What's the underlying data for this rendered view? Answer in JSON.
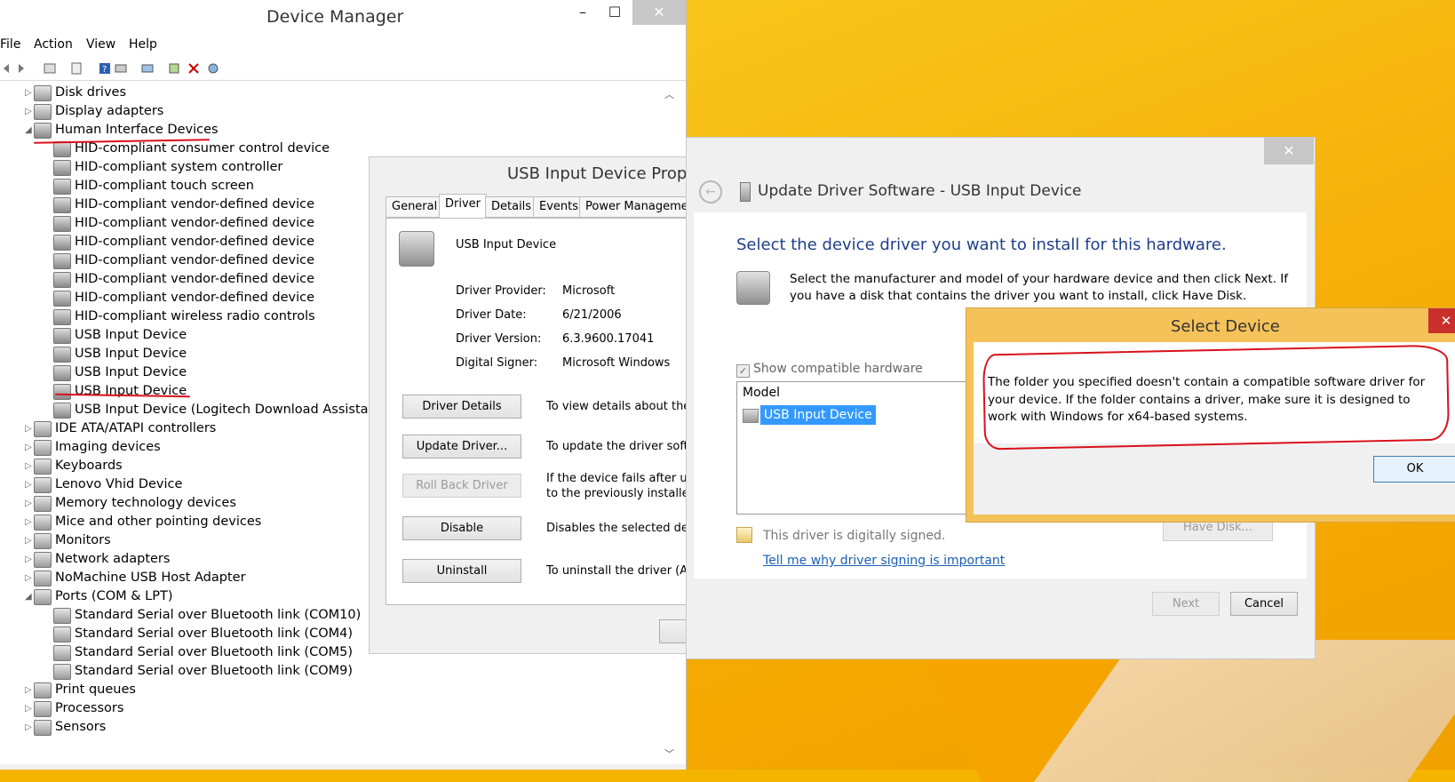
{
  "device_manager": {
    "title": "Device Manager",
    "window_controls": {
      "minimize": "–",
      "maximize": "☐",
      "close": "✕"
    },
    "menu": [
      "File",
      "Action",
      "View",
      "Help"
    ],
    "tree": [
      {
        "label": "Disk drives",
        "level": 0,
        "expanded": false
      },
      {
        "label": "Display adapters",
        "level": 0,
        "expanded": false
      },
      {
        "label": "Human Interface Devices",
        "level": 0,
        "expanded": true
      },
      {
        "label": "HID-compliant consumer control device",
        "level": 1
      },
      {
        "label": "HID-compliant system controller",
        "level": 1
      },
      {
        "label": "HID-compliant touch screen",
        "level": 1
      },
      {
        "label": "HID-compliant vendor-defined device",
        "level": 1
      },
      {
        "label": "HID-compliant vendor-defined device",
        "level": 1
      },
      {
        "label": "HID-compliant vendor-defined device",
        "level": 1
      },
      {
        "label": "HID-compliant vendor-defined device",
        "level": 1
      },
      {
        "label": "HID-compliant vendor-defined device",
        "level": 1
      },
      {
        "label": "HID-compliant vendor-defined device",
        "level": 1
      },
      {
        "label": "HID-compliant wireless radio controls",
        "level": 1
      },
      {
        "label": "USB Input Device",
        "level": 1
      },
      {
        "label": "USB Input Device",
        "level": 1
      },
      {
        "label": "USB Input Device",
        "level": 1
      },
      {
        "label": "USB Input Device",
        "level": 1
      },
      {
        "label": "USB Input Device (Logitech Download Assistant)",
        "level": 1
      },
      {
        "label": "IDE ATA/ATAPI controllers",
        "level": 0,
        "expanded": false
      },
      {
        "label": "Imaging devices",
        "level": 0,
        "expanded": false
      },
      {
        "label": "Keyboards",
        "level": 0,
        "expanded": false
      },
      {
        "label": "Lenovo Vhid Device",
        "level": 0,
        "expanded": false
      },
      {
        "label": "Memory technology devices",
        "level": 0,
        "expanded": false
      },
      {
        "label": "Mice and other pointing devices",
        "level": 0,
        "expanded": false
      },
      {
        "label": "Monitors",
        "level": 0,
        "expanded": false
      },
      {
        "label": "Network adapters",
        "level": 0,
        "expanded": false
      },
      {
        "label": "NoMachine USB Host Adapter",
        "level": 0,
        "expanded": false
      },
      {
        "label": "Ports (COM & LPT)",
        "level": 0,
        "expanded": true
      },
      {
        "label": "Standard Serial over Bluetooth link (COM10)",
        "level": 1
      },
      {
        "label": "Standard Serial over Bluetooth link (COM4)",
        "level": 1
      },
      {
        "label": "Standard Serial over Bluetooth link (COM5)",
        "level": 1
      },
      {
        "label": "Standard Serial over Bluetooth link (COM9)",
        "level": 1
      },
      {
        "label": "Print queues",
        "level": 0,
        "expanded": false
      },
      {
        "label": "Processors",
        "level": 0,
        "expanded": false
      },
      {
        "label": "Sensors",
        "level": 0,
        "expanded": false
      }
    ]
  },
  "properties": {
    "title": "USB Input Device Prope",
    "tabs": [
      "General",
      "Driver",
      "Details",
      "Events",
      "Power Managemen"
    ],
    "active_tab": "Driver",
    "device_name": "USB Input Device",
    "fields": {
      "provider_label": "Driver Provider:",
      "provider_value": "Microsoft",
      "date_label": "Driver Date:",
      "date_value": "6/21/2006",
      "version_label": "Driver Version:",
      "version_value": "6.3.9600.17041",
      "signer_label": "Digital Signer:",
      "signer_value": "Microsoft Windows"
    },
    "buttons": {
      "details": "Driver Details",
      "details_desc": "To view details about the d",
      "update": "Update Driver...",
      "update_desc": "To update the driver softw",
      "rollback": "Roll Back Driver",
      "rollback_desc1": "If the device fails after upd",
      "rollback_desc2": "to the previously installed",
      "disable": "Disable",
      "disable_desc": "Disables the selected dev",
      "uninstall": "Uninstall",
      "uninstall_desc": "To uninstall the driver (Adv"
    }
  },
  "update_driver": {
    "window_title": "Update Driver Software - USB Input Device",
    "heading": "Select the device driver you want to install for this hardware.",
    "description": "Select the manufacturer and model of your hardware device and then click Next. If you have a disk that contains the driver you want to install, click Have Disk.",
    "show_compatible": "Show compatible hardware",
    "model_header": "Model",
    "selected_model": "USB Input Device",
    "signed_text": "This driver is digitally signed.",
    "signing_link": "Tell me why driver signing is important",
    "have_disk": "Have Disk...",
    "next": "Next",
    "cancel": "Cancel"
  },
  "select_device": {
    "title": "Select Device",
    "message": "The folder you specified doesn't contain a compatible software driver for your device. If the folder contains a driver, make sure it is designed to work with Windows for x64-based systems.",
    "ok": "OK"
  }
}
